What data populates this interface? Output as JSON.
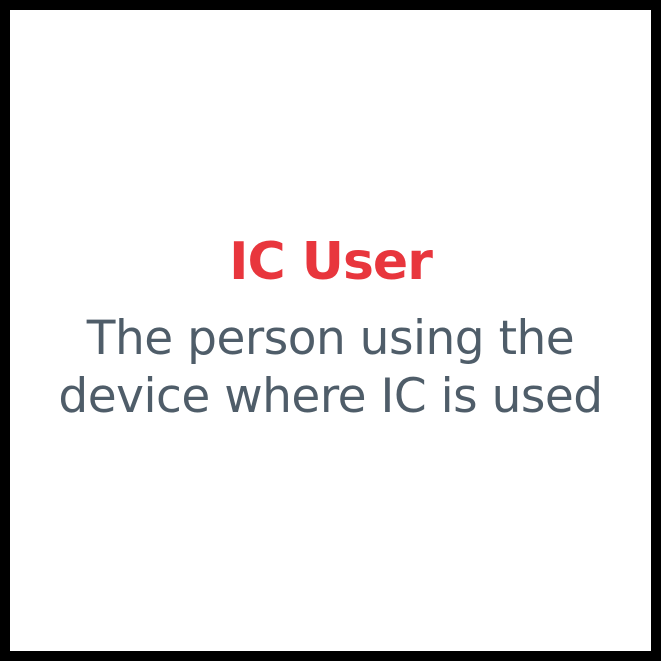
{
  "card": {
    "title": "IC User",
    "description_lines": [
      "The person using the",
      "device where IC is used"
    ]
  },
  "colors": {
    "title": "#e8363d",
    "description": "#4f5d69",
    "border": "#000000",
    "background": "#ffffff"
  }
}
